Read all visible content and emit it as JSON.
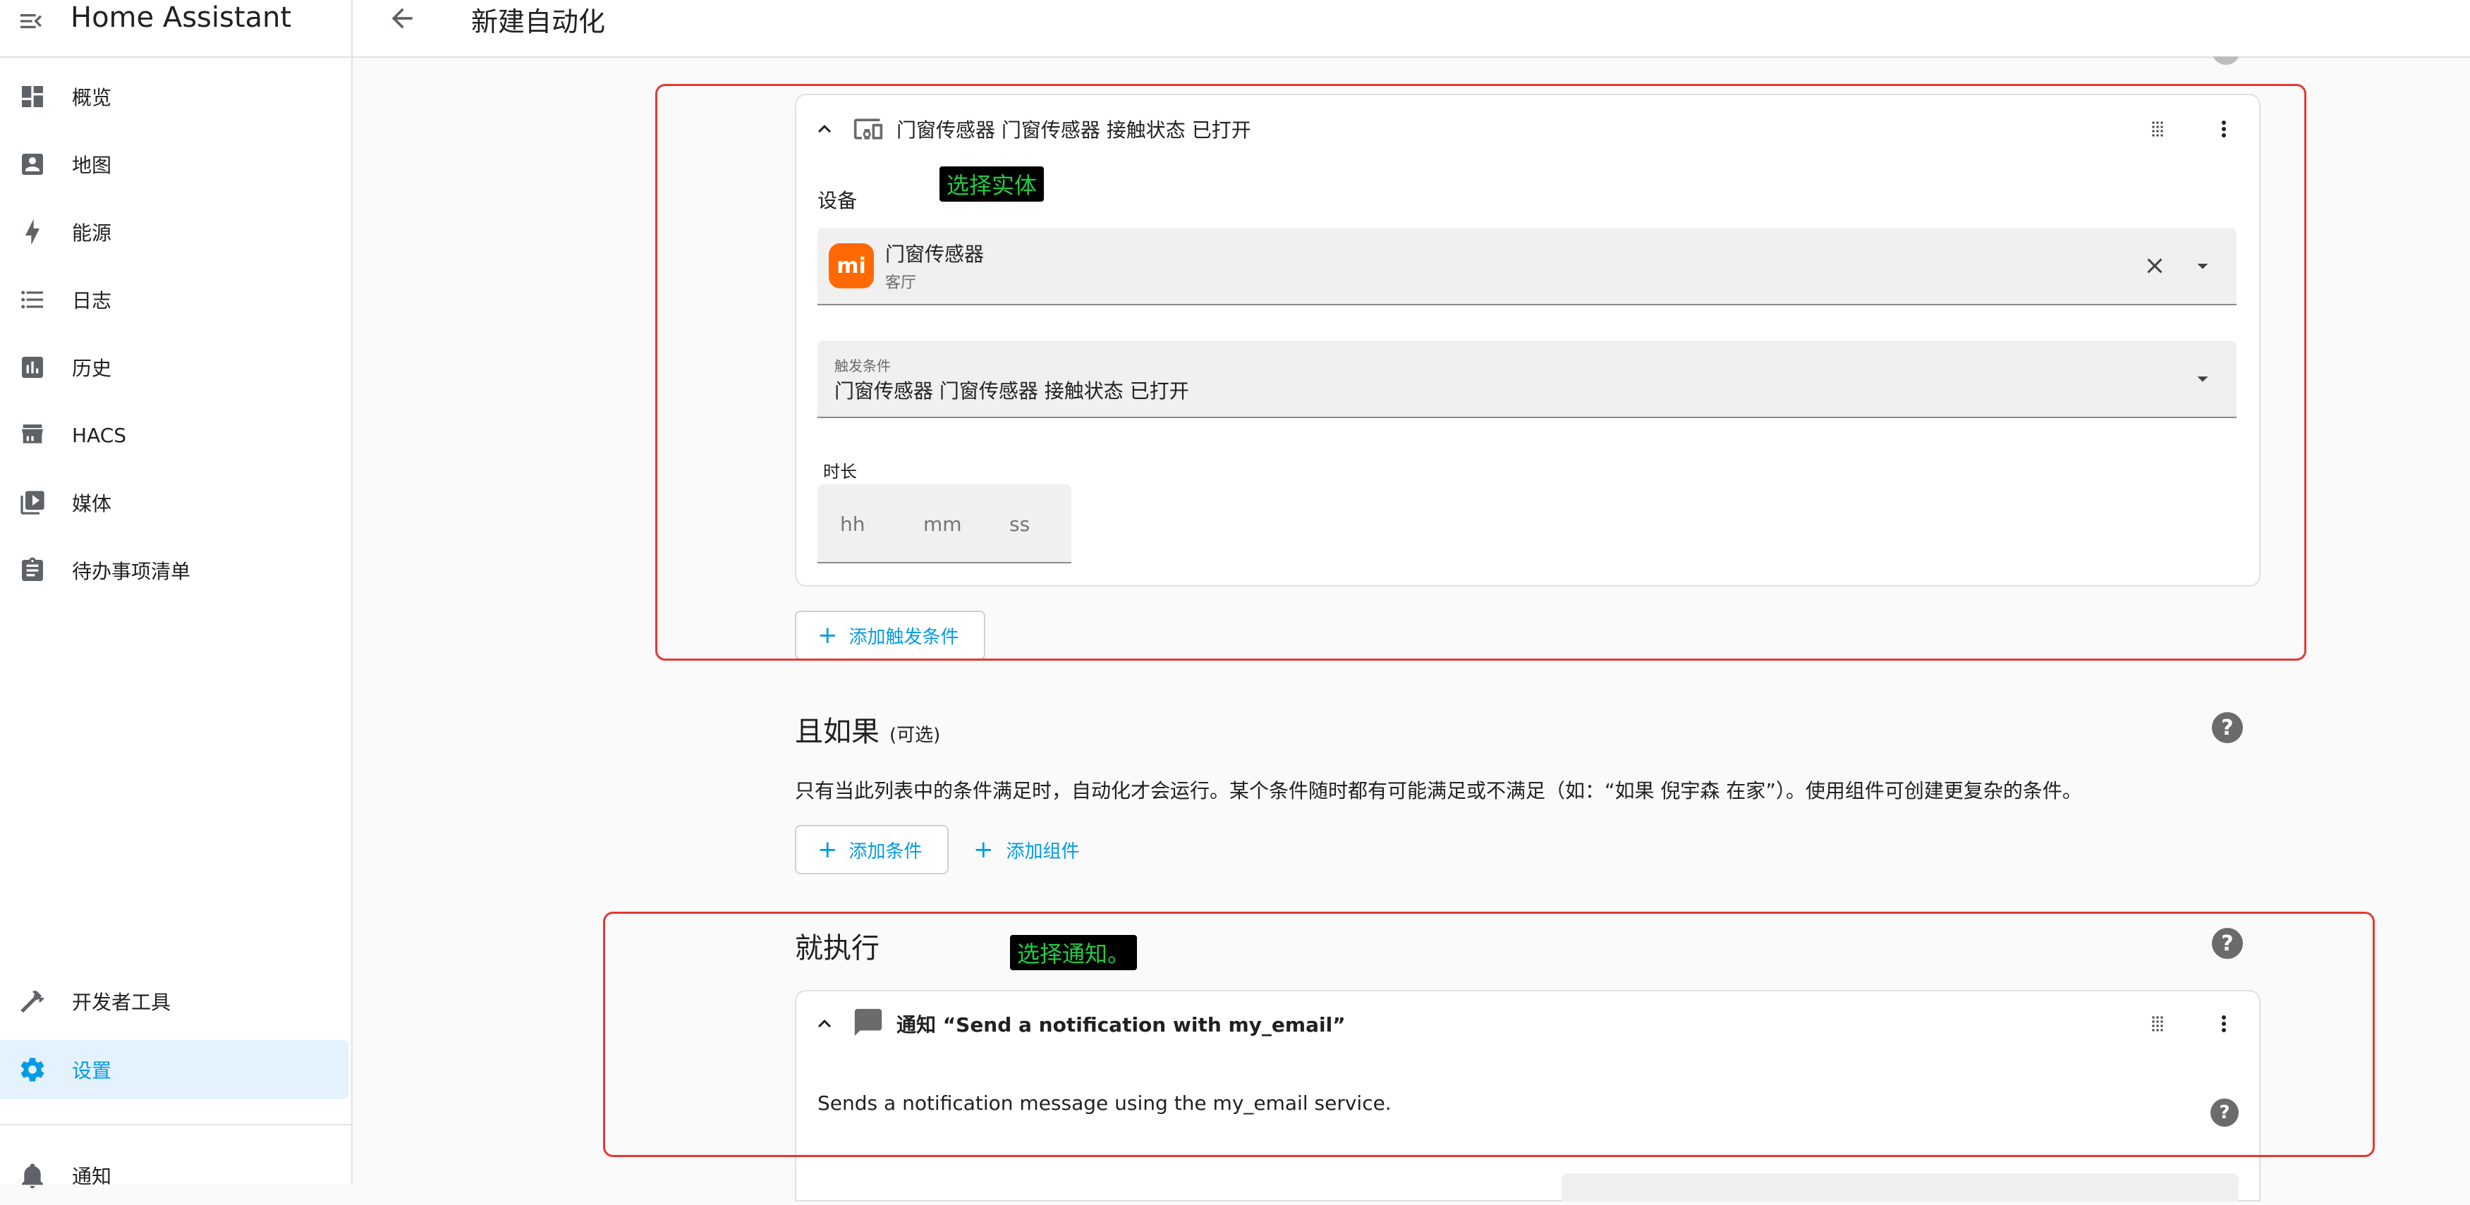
{
  "app": {
    "title": "Home Assistant"
  },
  "sidebar": {
    "items": [
      {
        "label": "概览",
        "icon": "dashboard-icon"
      },
      {
        "label": "地图",
        "icon": "map-account-icon"
      },
      {
        "label": "能源",
        "icon": "lightning-bolt-icon"
      },
      {
        "label": "日志",
        "icon": "format-list-icon"
      },
      {
        "label": "历史",
        "icon": "chart-box-icon"
      },
      {
        "label": "HACS",
        "icon": "hacs-store-icon"
      },
      {
        "label": "媒体",
        "icon": "play-box-multiple-icon"
      },
      {
        "label": "待办事项清单",
        "icon": "clipboard-list-icon"
      }
    ],
    "bottom_items": [
      {
        "label": "开发者工具",
        "icon": "hammer-icon"
      },
      {
        "label": "设置",
        "icon": "cog-icon",
        "active": true
      },
      {
        "label": "通知",
        "icon": "bell-icon"
      }
    ]
  },
  "header": {
    "title": "新建自动化"
  },
  "trigger_card": {
    "title": "门窗传感器 门窗传感器 接触状态 已打开",
    "device_label": "设备",
    "device_name": "门窗传感器",
    "device_area": "客厅",
    "device_logo_text": "mi",
    "trigger_field_label": "触发条件",
    "trigger_field_value": "门窗传感器 门窗传感器 接触状态 已打开",
    "duration_label": "时长",
    "duration_placeholders": {
      "hh": "hh",
      "mm": "mm",
      "ss": "ss"
    }
  },
  "add_trigger_label": "添加触发条件",
  "conditions": {
    "heading": "且如果",
    "optional": "(可选)",
    "description": "只有当此列表中的条件满足时，自动化才会运行。某个条件随时都有可能满足或不满足（如：“如果 倪宇森 在家”）。使用组件可创建更复杂的条件。",
    "add_condition_label": "添加条件",
    "add_building_block_label": "添加组件"
  },
  "actions": {
    "heading": "就执行",
    "card_title": "通知 “Send a notification with my_email”",
    "card_description": "Sends a notification message using the my_email service."
  },
  "annotations": {
    "select_entity": "选择实体",
    "select_notify": "选择通知。"
  },
  "colors": {
    "accent": "#039be5",
    "annotation_box": "#e53935",
    "annotation_text": "#22cc44",
    "xiaomi": "#ff6900"
  }
}
